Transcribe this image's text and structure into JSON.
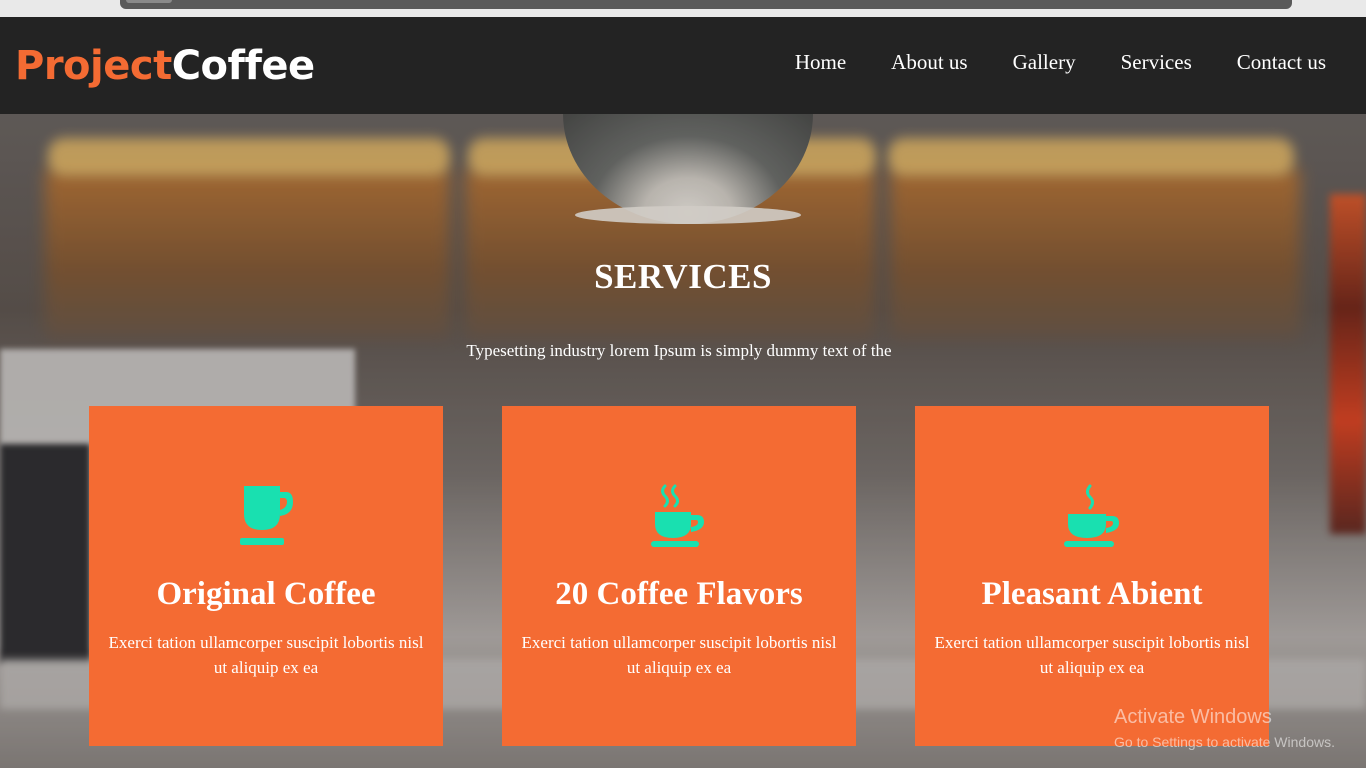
{
  "brand": {
    "part_a": "Project",
    "part_b": "Coffee"
  },
  "nav": {
    "items": [
      "Home",
      "About us",
      "Gallery",
      "Services",
      "Contact us"
    ]
  },
  "hero": {
    "title": "SERVICES",
    "subtitle": "Typesetting industry lorem Ipsum is simply dummy text of the"
  },
  "cards": [
    {
      "title": "Original Coffee",
      "text": "Exerci tation ullamcorper suscipit lobortis nisl ut aliquip ex ea",
      "icon": "coffee-mug-icon"
    },
    {
      "title": "20 Coffee Flavors",
      "text": "Exerci tation ullamcorper suscipit lobortis nisl ut aliquip ex ea",
      "icon": "steaming-cup-icon"
    },
    {
      "title": "Pleasant Abient",
      "text": "Exerci tation ullamcorper suscipit lobortis nisl ut aliquip ex ea",
      "icon": "coffee-cup-icon"
    }
  ],
  "watermark": {
    "title": "Activate Windows",
    "subtitle": "Go to Settings to activate Windows."
  },
  "colors": {
    "accent": "#f46b33",
    "icon": "#19e0b0",
    "navbar": "#232323"
  }
}
